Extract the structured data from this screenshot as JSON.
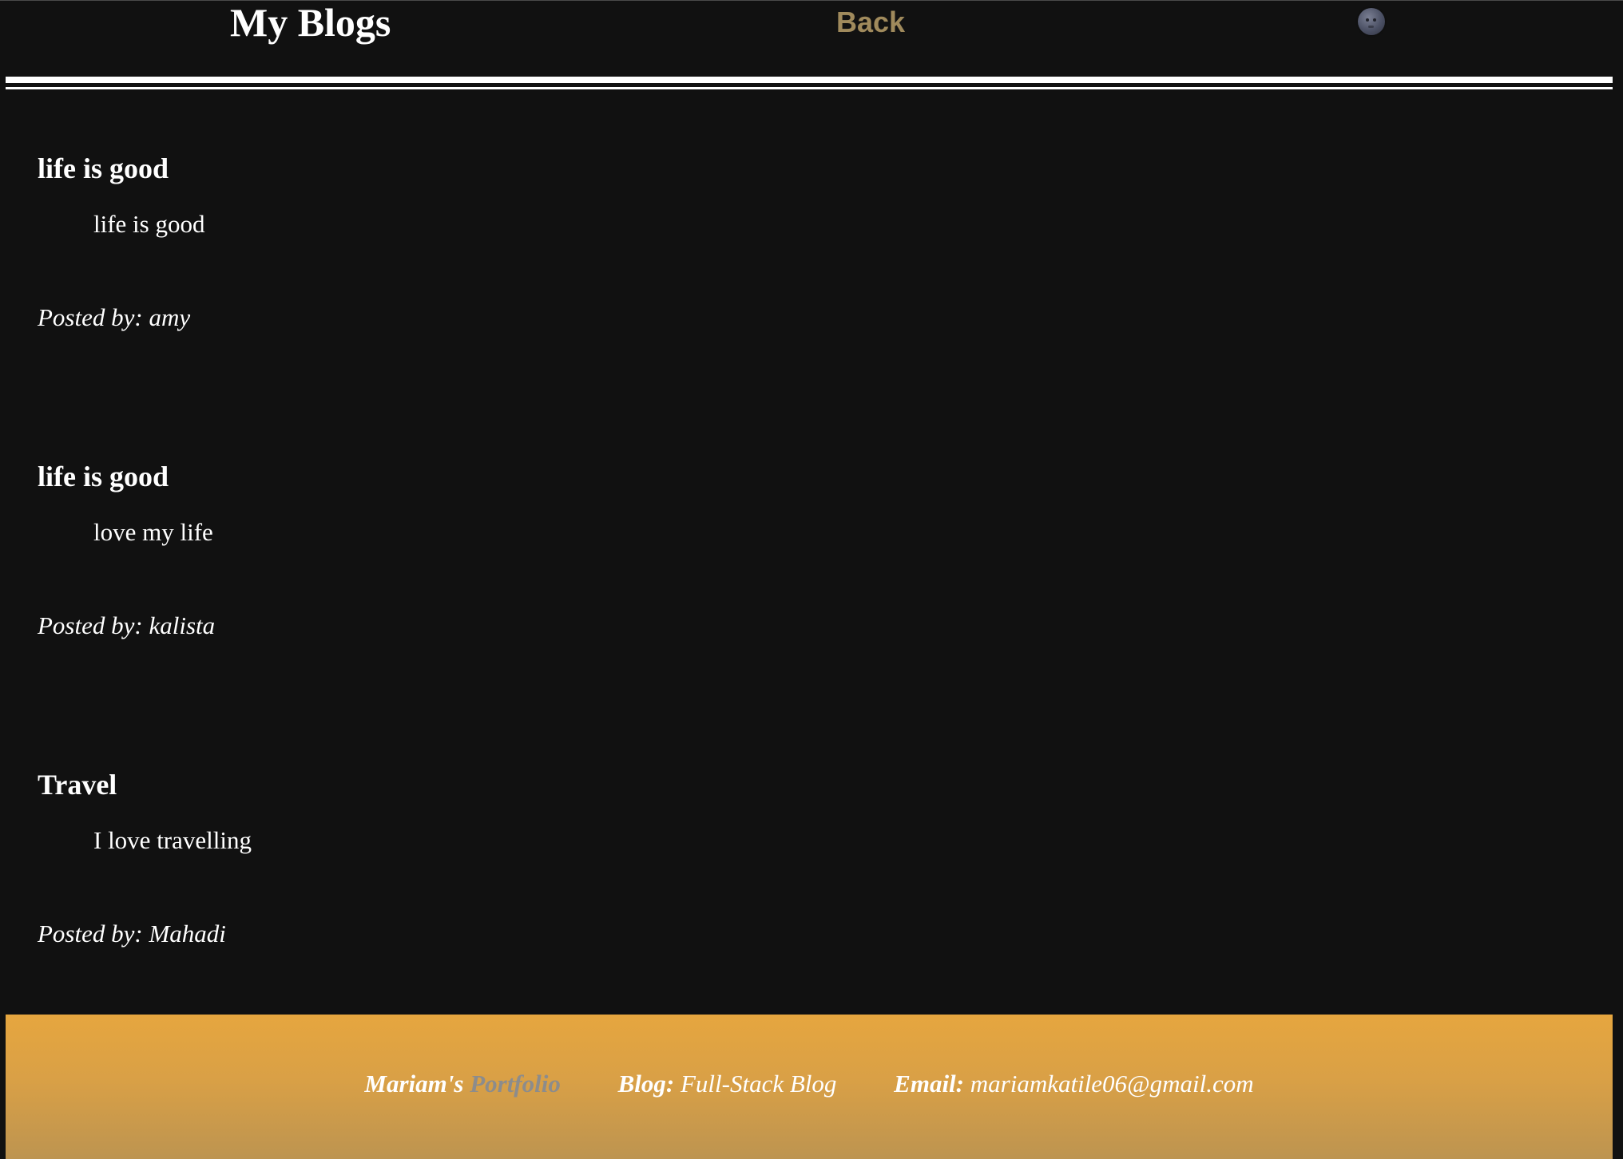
{
  "header": {
    "title": "My Blogs",
    "back_label": "Back",
    "theme_toggle_icon": "moon-face-icon"
  },
  "posts": [
    {
      "title": "life is good",
      "body": "life is good",
      "author_prefix": "Posted by:",
      "author": "amy"
    },
    {
      "title": "life is good",
      "body": "love my life",
      "author_prefix": "Posted by:",
      "author": "kalista"
    },
    {
      "title": "Travel",
      "body": "I love travelling",
      "author_prefix": "Posted by:",
      "author": "Mahadi"
    }
  ],
  "footer": {
    "owner": "Mariam's",
    "portfolio_word": "Portfolio",
    "blog_label": "Blog:",
    "blog_value": "Full-Stack Blog",
    "email_label": "Email:",
    "email_value": "mariamkatile06@gmail.com"
  },
  "colors": {
    "background": "#111111",
    "text": "#ffffff",
    "back_link": "#a08a5c",
    "footer_top": "#e6a63f",
    "footer_bottom": "#bd9450",
    "portfolio_word": "#8c8c8c"
  }
}
